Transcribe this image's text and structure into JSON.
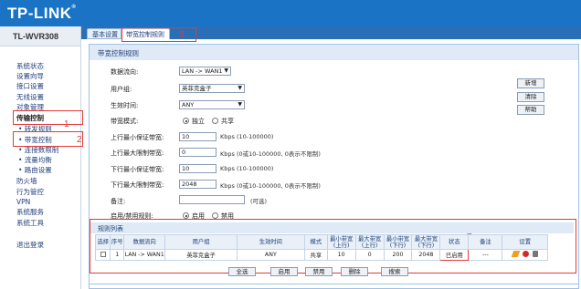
{
  "brand": {
    "logo": "TP-LINK",
    "reg": "®",
    "model": "TL-WVR308"
  },
  "sidebar": {
    "items": [
      {
        "label": "系统状态"
      },
      {
        "label": "设置向导"
      },
      {
        "label": "接口设置"
      },
      {
        "label": "无线设置"
      },
      {
        "label": "对象管理"
      },
      {
        "label": "传输控制"
      },
      {
        "label": "• 转发规则"
      },
      {
        "label": "• 带宽控制"
      },
      {
        "label": "• 连接数限制"
      },
      {
        "label": "• 流量均衡"
      },
      {
        "label": "• 路由设置"
      },
      {
        "label": "防火墙"
      },
      {
        "label": "行为管控"
      },
      {
        "label": "VPN"
      },
      {
        "label": "系统服务"
      },
      {
        "label": "系统工具"
      },
      {
        "label": "退出登录"
      }
    ]
  },
  "tabs": [
    {
      "label": "基本设置"
    },
    {
      "label": "带宽控制规则"
    }
  ],
  "annotations": [
    "1",
    "2",
    "3",
    "4"
  ],
  "form": {
    "title": "带宽控制规则",
    "direction": {
      "label": "数据流向:",
      "value": "LAN -> WAN1"
    },
    "usergroup": {
      "label": "用户组:",
      "value": "英菲克盒子"
    },
    "time": {
      "label": "生效时间:",
      "value": "ANY"
    },
    "mode": {
      "label": "带宽模式:",
      "opt1": "独立",
      "opt2": "共享",
      "selected": "独立"
    },
    "up_min": {
      "label": "上行最小保证带宽:",
      "value": "10",
      "hint": "Kbps (10-100000)"
    },
    "up_max": {
      "label": "上行最大限制带宽:",
      "value": "0",
      "hint": "Kbps (0或10-100000, 0表示不限制)"
    },
    "down_min": {
      "label": "下行最小保证带宽:",
      "value": "10",
      "hint": "Kbps (10-100000)"
    },
    "down_max": {
      "label": "下行最大限制带宽:",
      "value": "2048",
      "hint": "Kbps (0或10-100000, 0表示不限制)"
    },
    "remark": {
      "label": "备注:",
      "value": "",
      "hint": "(可选)"
    },
    "enable": {
      "label": "启用/禁用规则:",
      "opt1": "启用",
      "opt2": "禁用",
      "selected": "启用"
    },
    "buttons": {
      "new": "新增",
      "clear": "清除",
      "help": "帮助"
    }
  },
  "list": {
    "title": "规则列表",
    "headers": [
      "选择",
      "序号",
      "数据流向",
      "用户组",
      "生效时间",
      "模式",
      "最小带宽\n(上行)",
      "最大带宽\n(上行)",
      "最小带宽\n(下行)",
      "最大带宽\n(下行)",
      "状态",
      "备注",
      "设置"
    ],
    "rows": [
      {
        "index": "1",
        "direction": "LAN -> WAN1",
        "group": "英菲克盒子",
        "time": "ANY",
        "mode": "共享",
        "up_min": "10",
        "up_max": "0",
        "down_min": "200",
        "down_max": "2048",
        "status": "已启用",
        "remark": "---"
      }
    ],
    "buttons": {
      "select_all": "全选",
      "enable": "启用",
      "disable": "禁用",
      "delete": "删除",
      "search": "搜索"
    }
  },
  "colors": {
    "header": "#1a73c4",
    "accent_red": "#e23a3a",
    "panel_border": "#9ec3e6",
    "title_bg": "#dfeaf6"
  }
}
